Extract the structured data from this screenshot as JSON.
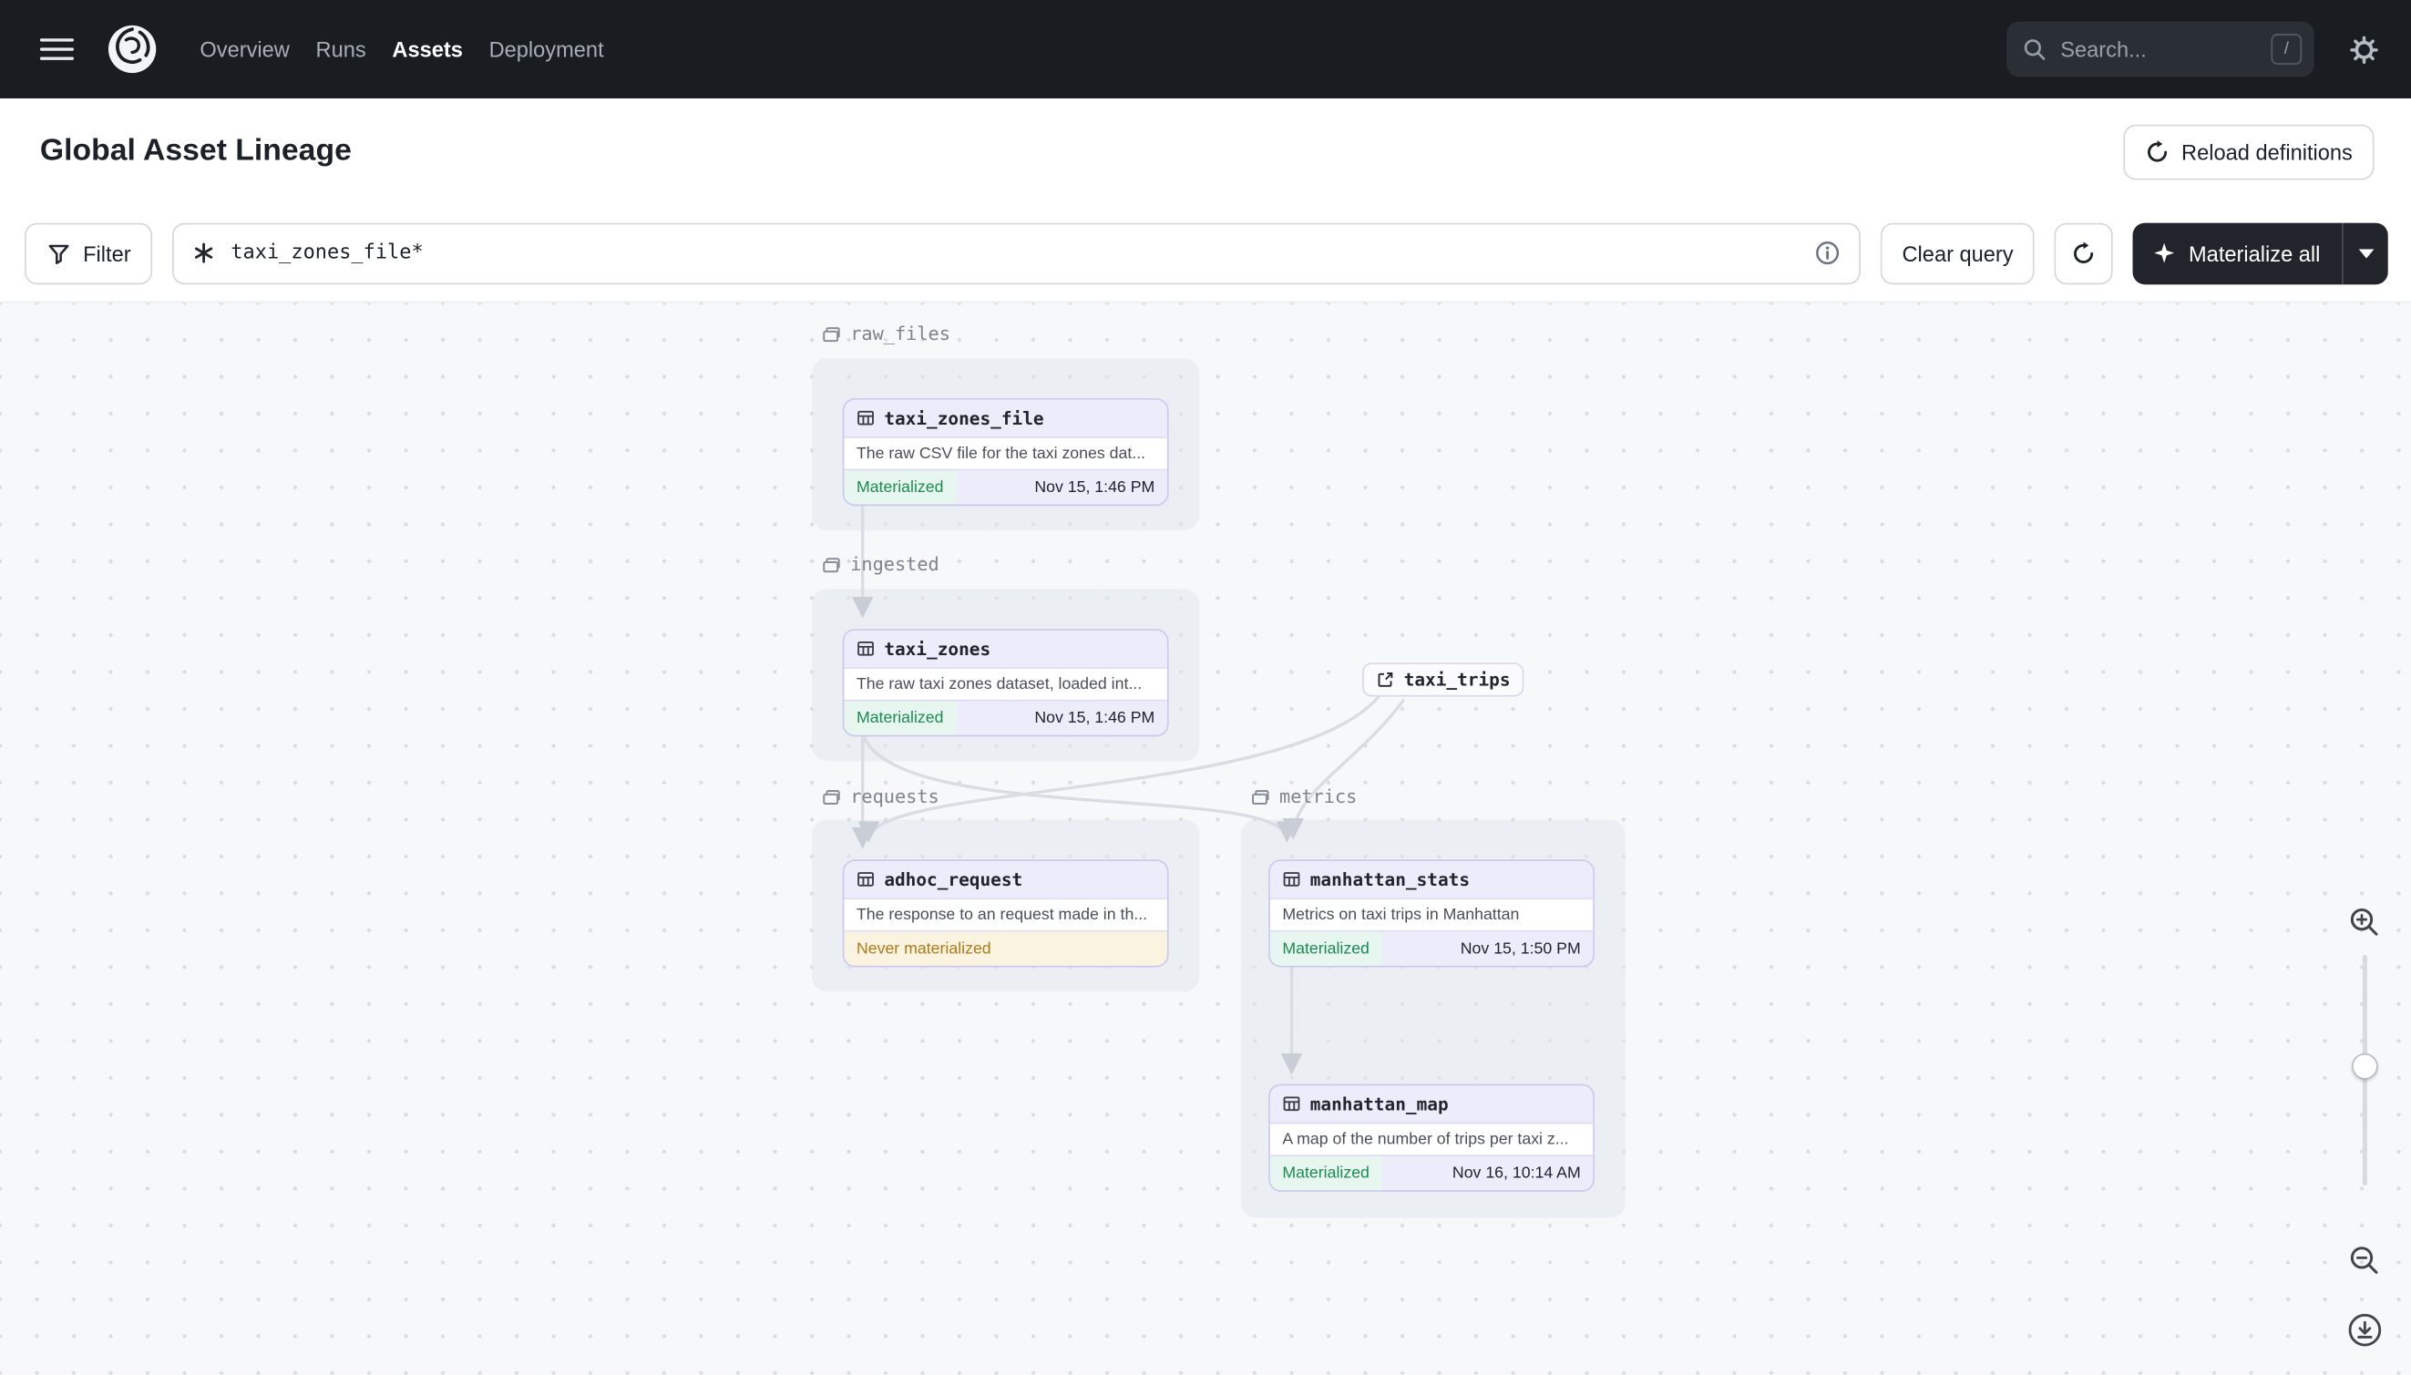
{
  "navbar": {
    "links": [
      {
        "label": "Overview",
        "active": false
      },
      {
        "label": "Runs",
        "active": false
      },
      {
        "label": "Assets",
        "active": true
      },
      {
        "label": "Deployment",
        "active": false
      }
    ],
    "search": {
      "placeholder": "Search...",
      "shortcut": "/"
    }
  },
  "header": {
    "title": "Global Asset Lineage",
    "reload_label": "Reload definitions"
  },
  "toolbar": {
    "filter_label": "Filter",
    "query_value": "taxi_zones_file*",
    "clear_label": "Clear query",
    "materialize_label": "Materialize all"
  },
  "graph": {
    "groups": [
      {
        "name": "raw_files"
      },
      {
        "name": "ingested"
      },
      {
        "name": "requests"
      },
      {
        "name": "metrics"
      }
    ],
    "external": {
      "label": "taxi_trips"
    },
    "nodes": [
      {
        "name": "taxi_zones_file",
        "description": "The raw CSV file for the taxi zones dat...",
        "status": "Materialized",
        "timestamp": "Nov 15, 1:46 PM"
      },
      {
        "name": "taxi_zones",
        "description": "The raw taxi zones dataset, loaded int...",
        "status": "Materialized",
        "timestamp": "Nov 15, 1:46 PM"
      },
      {
        "name": "adhoc_request",
        "description": "The response to an request made in th...",
        "status": "Never materialized",
        "timestamp": ""
      },
      {
        "name": "manhattan_stats",
        "description": "Metrics on taxi trips in Manhattan",
        "status": "Materialized",
        "timestamp": "Nov 15, 1:50 PM"
      },
      {
        "name": "manhattan_map",
        "description": "A map of the number of trips per taxi z...",
        "status": "Materialized",
        "timestamp": "Nov 16, 10:14 AM"
      }
    ]
  },
  "colors": {
    "navbar_bg": "#191C21",
    "node_border": "#C8C4EE",
    "materialized_green": "#1C8A53",
    "warning_amber": "#AD7A1C",
    "edge_gray": "#D9DCE2"
  }
}
